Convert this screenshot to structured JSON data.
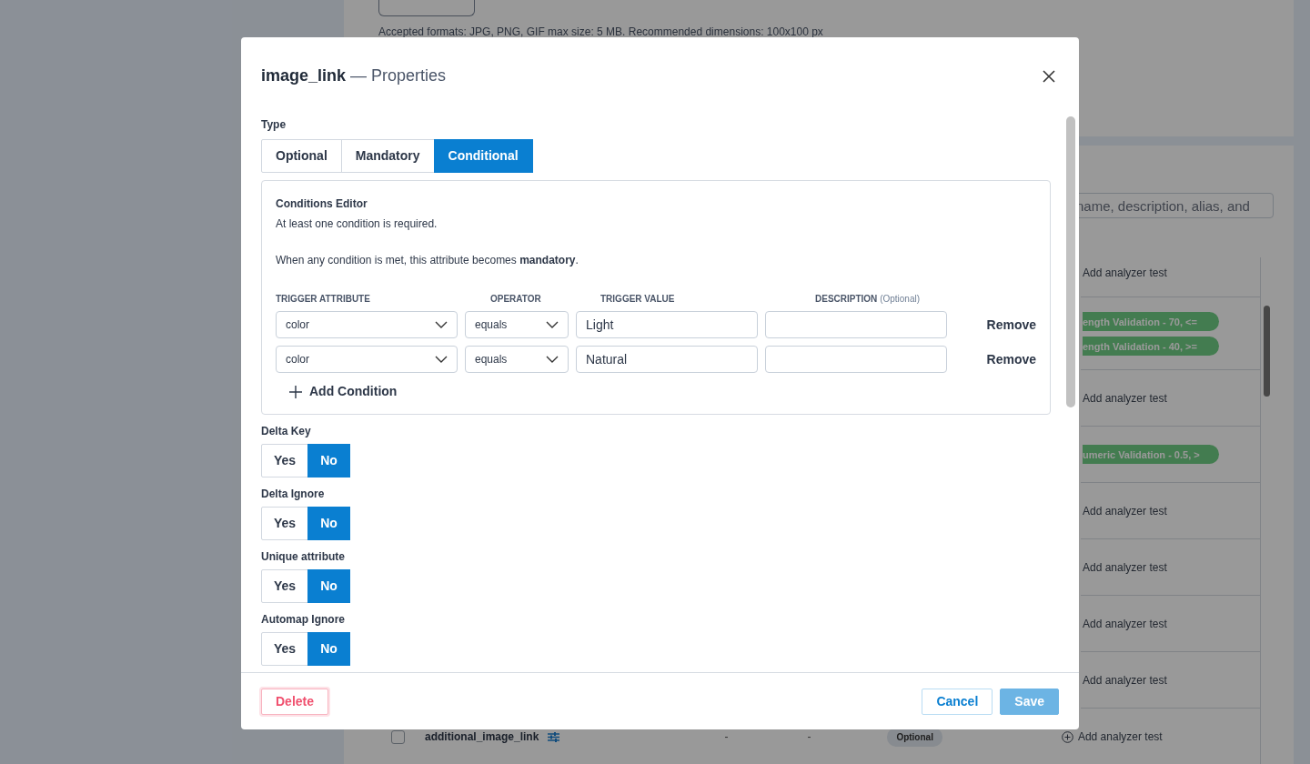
{
  "background": {
    "upload_hint": "Accepted formats: JPG, PNG, GIF max size: 5 MB. Recommended dimensions: 100x100 px",
    "search": {
      "placeholder": "name, description, alias, and"
    },
    "rows": [
      {
        "badges": [],
        "action": "Add analyzer test"
      },
      {
        "badges": [
          "ength Validation - 70, <=",
          "ength Validation - 40, >="
        ]
      },
      {
        "badges": [],
        "action": "Add analyzer test"
      },
      {
        "badges": [
          "umeric Validation - 0.5, >"
        ]
      },
      {
        "badges": [],
        "action": "Add analyzer test"
      },
      {
        "badges": [],
        "action": "Add analyzer test"
      },
      {
        "badges": [],
        "action": "Add analyzer test"
      },
      {
        "badges": [],
        "action": "Add analyzer test"
      }
    ],
    "last_row": {
      "checked": false,
      "name": "additional_image_link",
      "column_3": "-",
      "column_4": "-",
      "type": "Optional",
      "action": "Add analyzer test"
    }
  },
  "modal": {
    "title_name": "image_link",
    "title_suffix": "— Properties",
    "type": {
      "label": "Type",
      "options": [
        {
          "label": "Optional",
          "selected": false
        },
        {
          "label": "Mandatory",
          "selected": false
        },
        {
          "label": "Conditional",
          "selected": true
        }
      ]
    },
    "conditions_editor": {
      "title": "Conditions Editor",
      "note": "At least one condition is required.",
      "rule": "When any condition is met, this attribute becomes **mandatory**.",
      "columns": [
        {
          "label": "TRIGGER ATTRIBUTE"
        },
        {
          "label": "OPERATOR"
        },
        {
          "label": "TRIGGER VALUE"
        },
        {
          "label": "DESCRIPTION",
          "hint": "(Optional)"
        }
      ],
      "conditions": [
        {
          "attribute": "color",
          "operator": "equals",
          "value": "Light",
          "remove": "Remove"
        },
        {
          "attribute": "color",
          "operator": "equals",
          "value": "Natural",
          "remove": "Remove"
        }
      ],
      "add_label": "Add Condition"
    },
    "toggles": [
      {
        "label": "Delta Key",
        "options": [
          {
            "label": "Yes",
            "selected": false
          },
          {
            "label": "No",
            "selected": true
          }
        ]
      },
      {
        "label": "Delta Ignore",
        "options": [
          {
            "label": "Yes",
            "selected": false
          },
          {
            "label": "No",
            "selected": true
          }
        ]
      },
      {
        "label": "Unique attribute",
        "options": [
          {
            "label": "Yes",
            "selected": false
          },
          {
            "label": "No",
            "selected": true
          }
        ]
      },
      {
        "label": "Automap Ignore",
        "options": [
          {
            "label": "Yes",
            "selected": false
          },
          {
            "label": "No",
            "selected": true
          }
        ]
      }
    ],
    "footer": {
      "delete": "Delete",
      "cancel": "Cancel",
      "save": "Save",
      "save_disabled": true
    }
  }
}
